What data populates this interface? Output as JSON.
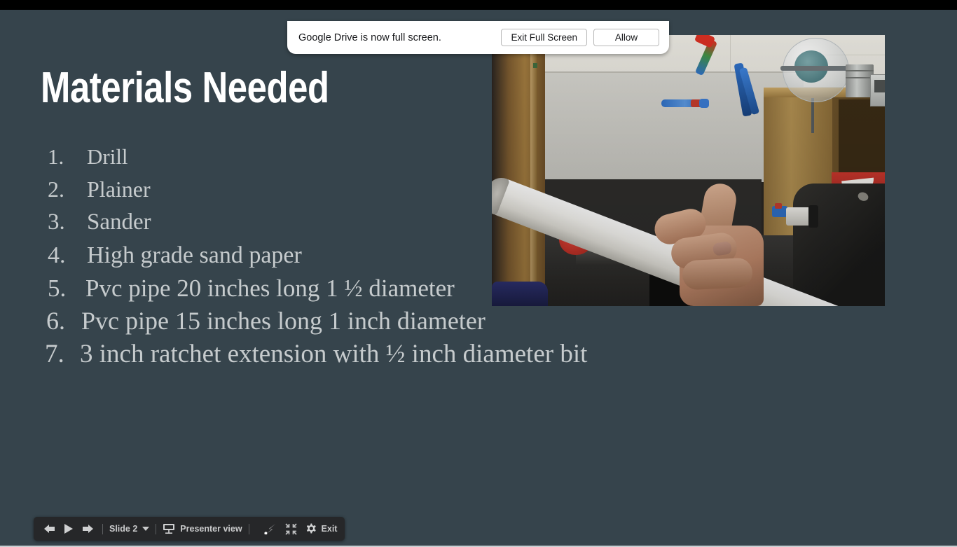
{
  "window": {
    "letterbox_color": "#000000",
    "slide_background": "#36444c"
  },
  "notification": {
    "message": "Google Drive is now full screen.",
    "exit_label": "Exit Full Screen",
    "allow_label": "Allow"
  },
  "slide": {
    "title": "Materials Needed",
    "title_color": "#ffffff",
    "body_color": "#c6cbcd",
    "items": [
      {
        "number": "1.",
        "text": "Drill"
      },
      {
        "number": "2.",
        "text": "Plainer"
      },
      {
        "number": "3.",
        "text": "Sander"
      },
      {
        "number": "4.",
        "text": "High grade sand paper"
      },
      {
        "number": "5.",
        "text": " Pvc pipe 20 inches long 1 ½  diameter"
      },
      {
        "number": "6.",
        "text": "Pvc pipe 15 inches long 1 inch diameter"
      },
      {
        "number": "7.",
        "text": "3 inch ratchet extension with ½ inch diameter bit"
      }
    ],
    "photo_alt": "Hand holding a long white PVC pipe in a workshop classroom with a globe, wooden shelf and tools"
  },
  "toolbar": {
    "prev_icon": "arrow-left-icon",
    "play_icon": "play-icon",
    "next_icon": "arrow-right-icon",
    "slide_label": "Slide 2",
    "presenter_icon": "projector-screen-icon",
    "presenter_label": "Presenter view",
    "laser_icon": "laser-pointer-icon",
    "shrink_icon": "shrink-fullscreen-icon",
    "settings_icon": "gear-icon",
    "exit_label": "Exit"
  }
}
